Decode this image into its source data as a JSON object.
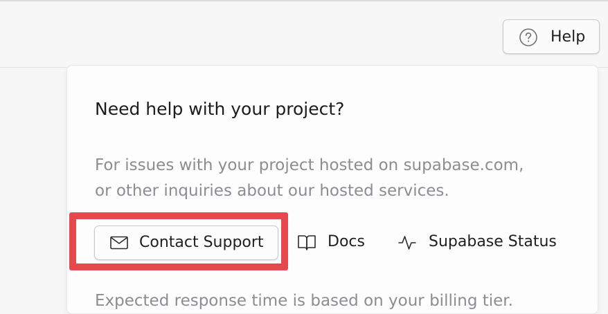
{
  "header": {
    "help_button": {
      "label": "Help",
      "icon": "help-circle-icon"
    }
  },
  "help_panel": {
    "title": "Need help with your project?",
    "description_lines": [
      "For issues with your project hosted on supabase.com,",
      "or other inquiries about our hosted services."
    ],
    "actions": {
      "contact_support": {
        "label": "Contact Support",
        "icon": "mail-icon"
      },
      "docs": {
        "label": "Docs",
        "icon": "book-open-icon"
      },
      "status": {
        "label": "Supabase Status",
        "icon": "activity-icon"
      }
    },
    "footer_text": "Expected response time is based on your billing tier."
  },
  "colors": {
    "highlight": "#e5484d",
    "text_primary": "#1f1f22",
    "text_muted": "#8c8c93"
  }
}
